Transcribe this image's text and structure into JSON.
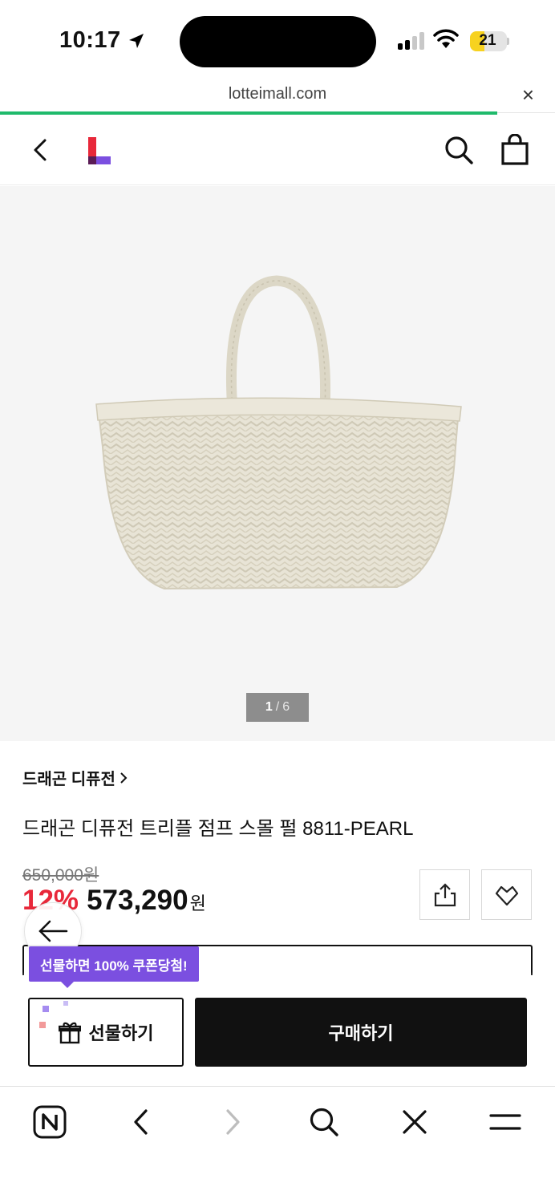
{
  "status_bar": {
    "time": "10:17",
    "battery": "21"
  },
  "browser": {
    "url": "lotteimall.com",
    "close_symbol": "×"
  },
  "header": {
    "logo": "L"
  },
  "gallery": {
    "current": "1",
    "separator": "/",
    "total": "6"
  },
  "product": {
    "brand": "드래곤 디퓨전",
    "title": "드래곤 디퓨전 트리플 점프 스몰 펄 8811-PEARL",
    "original_price": "650,000원",
    "discount": "12%",
    "price": "573,290",
    "currency": "원"
  },
  "purchase": {
    "gift_tooltip": "선물하면 100% 쿠폰당첨!",
    "gift_label": "선물하기",
    "buy_label": "구매하기"
  },
  "toolbar": {
    "items": [
      "n-icon",
      "back-icon",
      "forward-icon",
      "search-icon",
      "close-icon",
      "menu-icon"
    ]
  },
  "colors": {
    "accent_green": "#1fba6b",
    "discount_red": "#e8283a",
    "tooltip_purple": "#7b4fe0",
    "battery_yellow": "#f7d21f"
  }
}
